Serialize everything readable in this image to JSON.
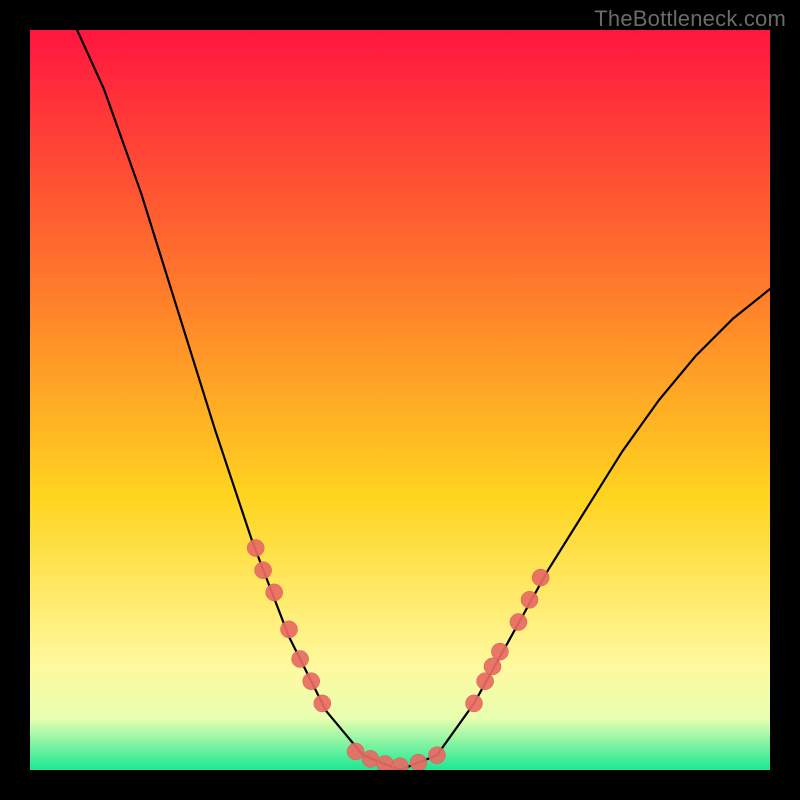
{
  "watermark": "TheBottleneck.com",
  "colors": {
    "background": "#000000",
    "gradient_top": "#ff163f",
    "gradient_mid1": "#ff7b2b",
    "gradient_mid2": "#ffd41f",
    "gradient_mid3": "#fff99f",
    "gradient_bottom_highlight": "#e8ffb0",
    "gradient_bottom": "#1be894",
    "curve": "#000000",
    "marker_fill": "#e86a63",
    "marker_stroke": "#d85a53"
  },
  "chart_data": {
    "type": "line",
    "title": "",
    "xlabel": "",
    "ylabel": "",
    "xlim": [
      0,
      100
    ],
    "ylim": [
      0,
      100
    ],
    "curve": [
      {
        "x": 5,
        "y": 103
      },
      {
        "x": 10,
        "y": 92
      },
      {
        "x": 15,
        "y": 78
      },
      {
        "x": 20,
        "y": 62
      },
      {
        "x": 25,
        "y": 46
      },
      {
        "x": 30,
        "y": 31
      },
      {
        "x": 35,
        "y": 18
      },
      {
        "x": 40,
        "y": 8
      },
      {
        "x": 45,
        "y": 2
      },
      {
        "x": 50,
        "y": 0
      },
      {
        "x": 55,
        "y": 2
      },
      {
        "x": 60,
        "y": 9
      },
      {
        "x": 65,
        "y": 18
      },
      {
        "x": 70,
        "y": 27
      },
      {
        "x": 75,
        "y": 35
      },
      {
        "x": 80,
        "y": 43
      },
      {
        "x": 85,
        "y": 50
      },
      {
        "x": 90,
        "y": 56
      },
      {
        "x": 95,
        "y": 61
      },
      {
        "x": 100,
        "y": 65
      }
    ],
    "markers_left": [
      {
        "x": 30.5,
        "y": 30
      },
      {
        "x": 31.5,
        "y": 27
      },
      {
        "x": 33,
        "y": 24
      },
      {
        "x": 35,
        "y": 19
      },
      {
        "x": 36.5,
        "y": 15
      },
      {
        "x": 38,
        "y": 12
      },
      {
        "x": 39.5,
        "y": 9
      }
    ],
    "markers_bottom": [
      {
        "x": 44,
        "y": 2.5
      },
      {
        "x": 46,
        "y": 1.5
      },
      {
        "x": 48,
        "y": 0.8
      },
      {
        "x": 50,
        "y": 0.5
      },
      {
        "x": 52.5,
        "y": 1.0
      },
      {
        "x": 55,
        "y": 2.0
      }
    ],
    "markers_right": [
      {
        "x": 60,
        "y": 9
      },
      {
        "x": 61.5,
        "y": 12
      },
      {
        "x": 62.5,
        "y": 14
      },
      {
        "x": 63.5,
        "y": 16
      },
      {
        "x": 66,
        "y": 20
      },
      {
        "x": 67.5,
        "y": 23
      },
      {
        "x": 69,
        "y": 26
      }
    ]
  }
}
